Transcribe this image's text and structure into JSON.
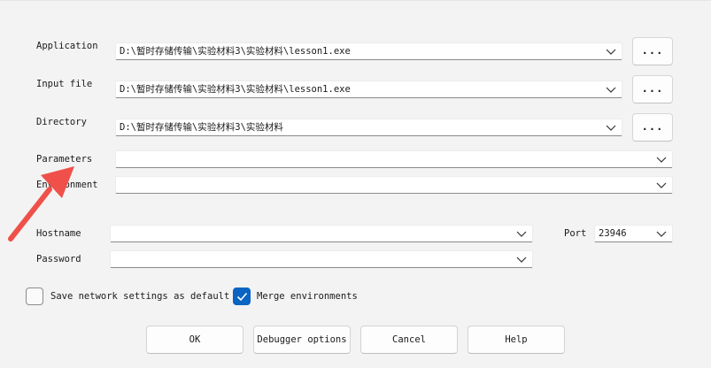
{
  "fields": {
    "application": {
      "label": "Application",
      "value": "D:\\暂时存储传输\\实验材料3\\实验材料\\lesson1.exe"
    },
    "input_file": {
      "label": "Input file",
      "value": "D:\\暂时存储传输\\实验材料3\\实验材料\\lesson1.exe"
    },
    "directory": {
      "label": "Directory",
      "value": "D:\\暂时存储传输\\实验材料3\\实验材料"
    },
    "parameters": {
      "label": "Parameters",
      "value": ""
    },
    "environment": {
      "label": "Environment",
      "value": ""
    },
    "hostname": {
      "label": "Hostname",
      "value": ""
    },
    "password": {
      "label": "Password",
      "value": ""
    },
    "port": {
      "label": "Port",
      "value": "23946"
    }
  },
  "browse_label": "...",
  "checkboxes": {
    "save_network": {
      "label": "Save network settings as default",
      "checked": false
    },
    "merge_env": {
      "label": "Merge environments",
      "checked": true
    }
  },
  "buttons": {
    "ok": "OK",
    "debugger_options": "Debugger options",
    "cancel": "Cancel",
    "help": "Help"
  },
  "colors": {
    "accent": "#0a64c2",
    "annotation_arrow": "#f0504a"
  }
}
